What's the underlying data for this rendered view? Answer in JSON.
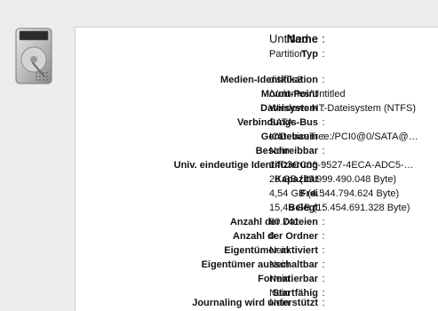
{
  "info": {
    "header": [
      {
        "key": "Name",
        "value": "Untitled"
      },
      {
        "key": "Typ",
        "value": "Partition"
      }
    ],
    "rows": [
      {
        "key": "Medien-Identifikation",
        "value": "disk0s3"
      },
      {
        "key": "Mount-Point",
        "value": "/Volumes/Untitled"
      },
      {
        "key": "Dateisystem",
        "value": "Windows NT-Dateisystem (NTFS)"
      },
      {
        "key": "Verbindungs-Bus",
        "value": "SATA"
      },
      {
        "key": "Gerätebaum",
        "value": "IODeviceTree:/PCI0@0/SATA@…"
      },
      {
        "key": "Beschreibbar",
        "value": "Nein"
      },
      {
        "key": "Univ. eindeutige Identifizierung",
        "value": "14C3CC06-9527-4ECA-ADC5-…"
      },
      {
        "key": "Kapazität",
        "value": "20 GB (19.999.490.048 Byte)"
      },
      {
        "key": "Frei",
        "value": "4,54 GB (4.544.794.624 Byte)"
      },
      {
        "key": "Belegt",
        "value": "15,45 GB (15.454.691.328 Byte)"
      },
      {
        "key": "Anzahl der Dateien",
        "value": "60.741"
      },
      {
        "key": "Anzahl der Ordner",
        "value": "0"
      },
      {
        "key": "Eigentümer aktiviert",
        "value": "Nein"
      },
      {
        "key": "Eigentümer ausschaltbar",
        "value": "Nein"
      },
      {
        "key": "Formatierbar",
        "value": "Nein"
      },
      {
        "key": "Startfähig",
        "value": "Nein"
      },
      {
        "key": "Journaling wird unterstützt",
        "value": "Nein"
      }
    ]
  },
  "icon": {
    "name": "hard-drive-icon"
  }
}
